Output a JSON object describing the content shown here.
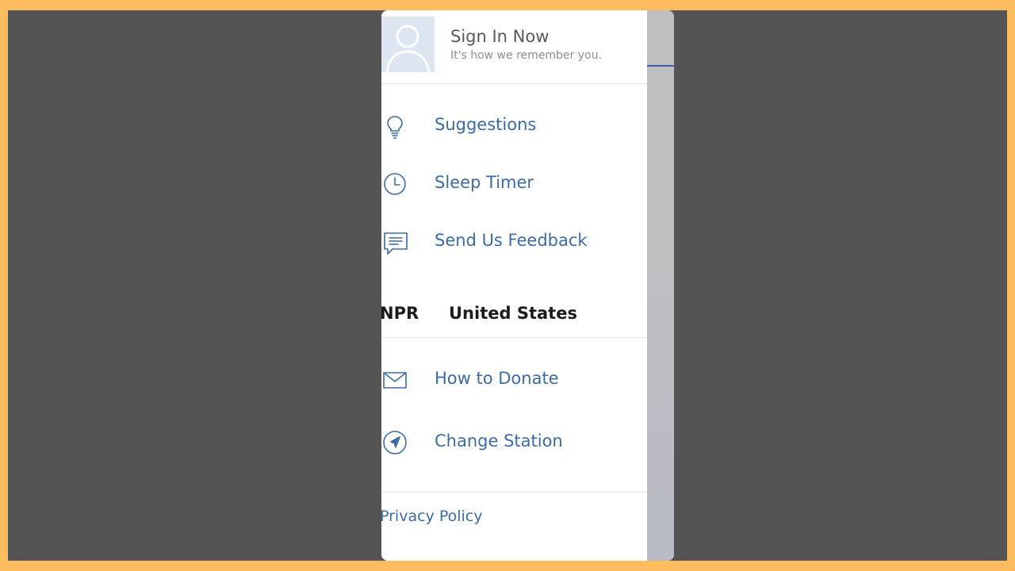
{
  "profile": {
    "title": "Sign In Now",
    "subtitle": "It's how we remember you.",
    "avatar_icon": "user-silhouette-icon"
  },
  "menu": {
    "items": [
      {
        "label": "Suggestions",
        "icon": "lightbulb-icon"
      },
      {
        "label": "Sleep Timer",
        "icon": "clock-icon"
      },
      {
        "label": "Send Us Feedback",
        "icon": "chat-bubble-icon"
      }
    ]
  },
  "station_section": {
    "network": "NPR",
    "region": "United States",
    "items": [
      {
        "label": "How to Donate",
        "icon": "envelope-icon"
      },
      {
        "label": "Change Station",
        "icon": "compass-icon"
      }
    ]
  },
  "footer": {
    "privacy_label": "Privacy Policy"
  },
  "colors": {
    "frame_border": "#FDBC5E",
    "backdrop": "#545454",
    "link_blue": "#3B6BA8",
    "overlay": "#BFBFBF"
  }
}
